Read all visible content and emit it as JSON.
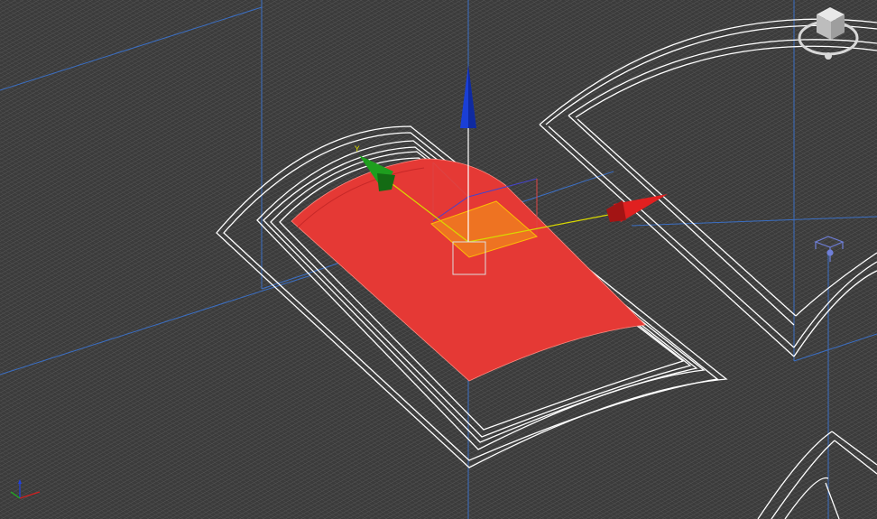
{
  "viewport": {
    "type": "3d-perspective-wireframe",
    "background_color": "#3b3b3b",
    "grid_color": "#555555",
    "guide_line_color": "#3b6fc4"
  },
  "objects": [
    {
      "name": "selected-roof-panel",
      "selected": true,
      "fill_color": "#e53935",
      "edge_color": "#ffffff"
    },
    {
      "name": "roof-frame-right",
      "selected": false,
      "edge_color": "#ffffff"
    },
    {
      "name": "roof-frame-bottom-right",
      "selected": false,
      "edge_color": "#ffffff"
    }
  ],
  "move_gizmo": {
    "x_axis": {
      "label": "",
      "color": "#e02020"
    },
    "y_axis": {
      "label": "Y",
      "color": "#1e9e1e"
    },
    "z_axis": {
      "label": "",
      "color": "#1a3fd6"
    },
    "plane_handle_color": "#f07a20"
  },
  "view_cube": {
    "icon": "view-cube-icon",
    "color": "#d8d8d8"
  },
  "light_gizmo": {
    "icon": "light-target-icon",
    "color": "#6f7fd8"
  },
  "axis_triad": {
    "icon": "axis-triad-icon",
    "x_color": "#d02020",
    "y_color": "#20b020",
    "z_color": "#2040e0"
  }
}
